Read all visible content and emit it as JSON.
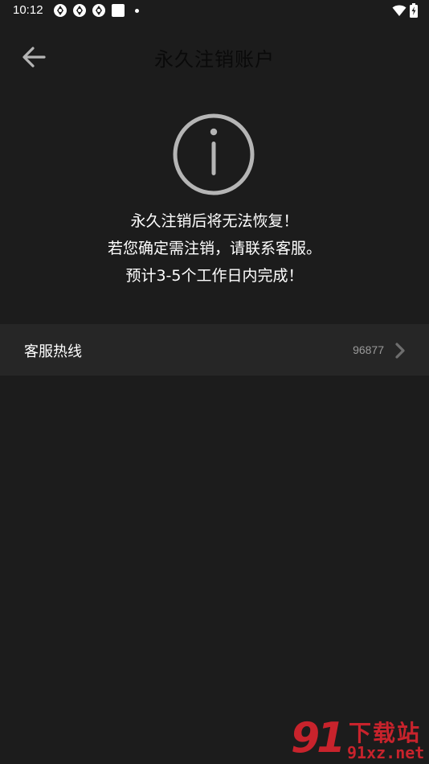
{
  "status_bar": {
    "time": "10:12"
  },
  "app_bar": {
    "title": "永久注销账户"
  },
  "info": {
    "lines": [
      "永久注销后将无法恢复！",
      "若您确定需注销，请联系客服。",
      "预计3-5个工作日内完成！"
    ]
  },
  "hotline": {
    "label": "客服热线",
    "number": "96877"
  },
  "watermark": {
    "logo_mark": "91",
    "site_name": "下载站",
    "url": "91xz.net"
  },
  "colors": {
    "background": "#1c1c1c",
    "row_background": "#262626",
    "icon_gray": "#b5b5b5",
    "secondary_text": "#9a9a9a",
    "watermark_red": "#c8232c"
  }
}
